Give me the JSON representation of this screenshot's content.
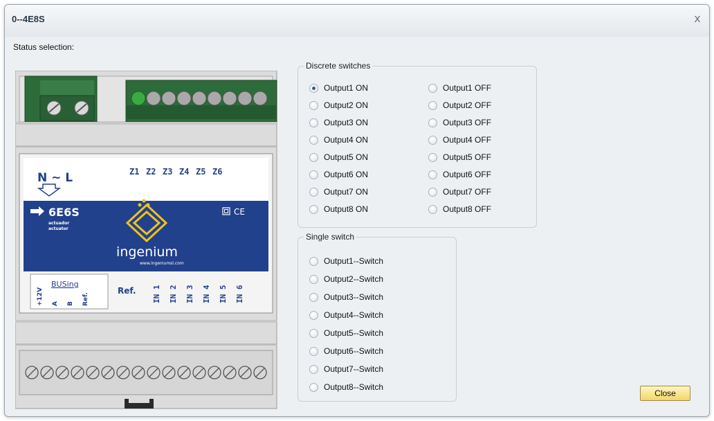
{
  "window": {
    "title": "0--4E8S",
    "close_glyph": "x"
  },
  "status_label": "Status selection:",
  "device": {
    "supply_label": "N ~ L",
    "zone_labels": [
      "Z1",
      "Z2",
      "Z3",
      "Z4",
      "Z5",
      "Z6"
    ],
    "model": "6E6S",
    "model_sub1": "actuador",
    "model_sub2": "actuator",
    "ce_mark": "CE",
    "brand": "ingenium",
    "website": "www.ingeniumsl.com",
    "bus_labels": [
      "+12V",
      "A",
      "B",
      "Ref."
    ],
    "bus_logo": "BUSing",
    "ref_label": "Ref.",
    "input_labels": [
      "IN 1",
      "IN 2",
      "IN 3",
      "IN 4",
      "IN 5",
      "IN 6"
    ],
    "colors": {
      "terminal_green": "#2d6b3a",
      "panel_blue": "#22418c",
      "body_grey": "#dcdcdc"
    }
  },
  "discrete_switches": {
    "legend": "Discrete switches",
    "on_options": [
      "Output1 ON",
      "Output2 ON",
      "Output3 ON",
      "Output4 ON",
      "Output5 ON",
      "Output6 ON",
      "Output7 ON",
      "Output8 ON"
    ],
    "off_options": [
      "Output1 OFF",
      "Output2 OFF",
      "Output3 OFF",
      "Output4 OFF",
      "Output5 OFF",
      "Output6 OFF",
      "Output7 OFF",
      "Output8 OFF"
    ],
    "selected": "Output1 ON"
  },
  "single_switch": {
    "legend": "Single switch",
    "options": [
      "Output1--Switch",
      "Output2--Switch",
      "Output3--Switch",
      "Output4--Switch",
      "Output5--Switch",
      "Output6--Switch",
      "Output7--Switch",
      "Output8--Switch"
    ]
  },
  "buttons": {
    "close": "Close"
  },
  "colors": {
    "dialog_bg": "#edf0f3",
    "button_fill": "#f3d66a",
    "radio_dot": "#3d5f86"
  }
}
